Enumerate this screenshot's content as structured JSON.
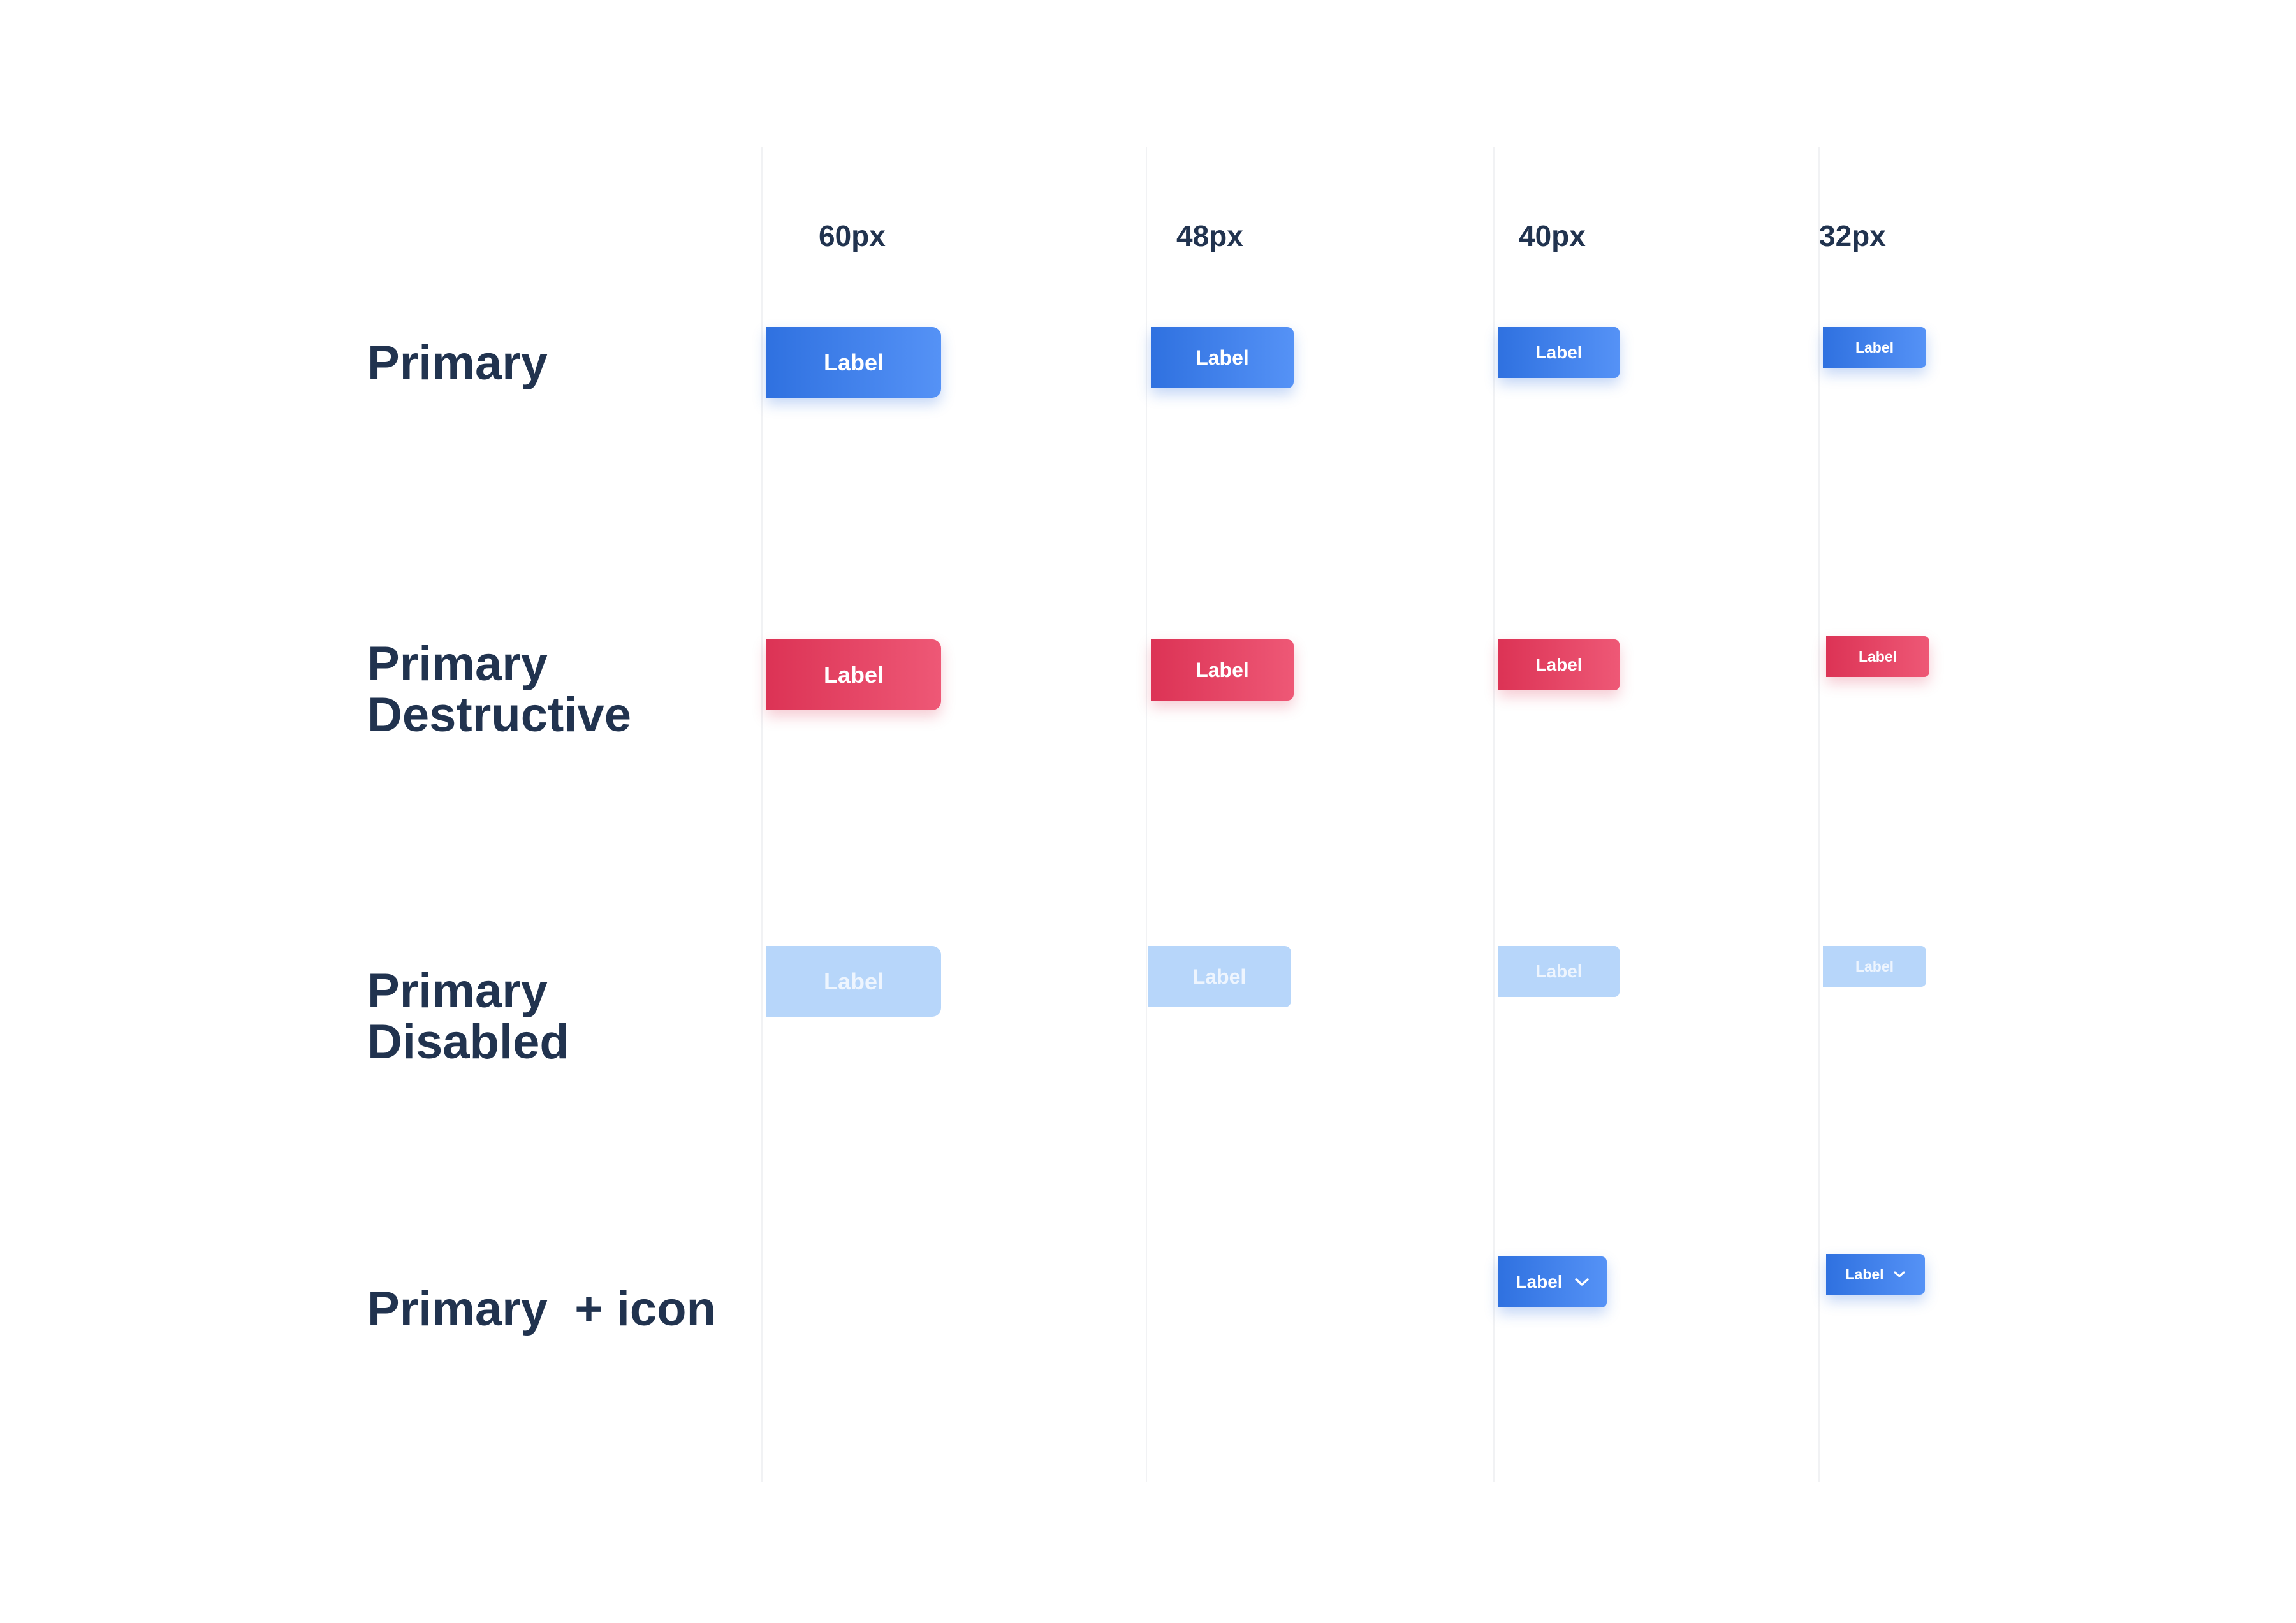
{
  "columns": {
    "size_60": "60px",
    "size_48": "48px",
    "size_40": "40px",
    "size_32": "32px"
  },
  "rows": {
    "primary": "Primary",
    "destructive_line1": "Primary",
    "destructive_line2": "Destructive",
    "disabled_line1": "Primary",
    "disabled_line2": "Disabled",
    "icon": "Primary  + icon"
  },
  "button_label": "Label",
  "icons": {
    "dropdown": "chevron-down-icon"
  },
  "colors": {
    "text_dark": "#21334f",
    "primary_start": "#2f71e0",
    "primary_end": "#5592f6",
    "destructive_start": "#dc3355",
    "destructive_end": "#ee5876",
    "disabled": "#b7d6fa",
    "divider": "#f1f2f4"
  }
}
